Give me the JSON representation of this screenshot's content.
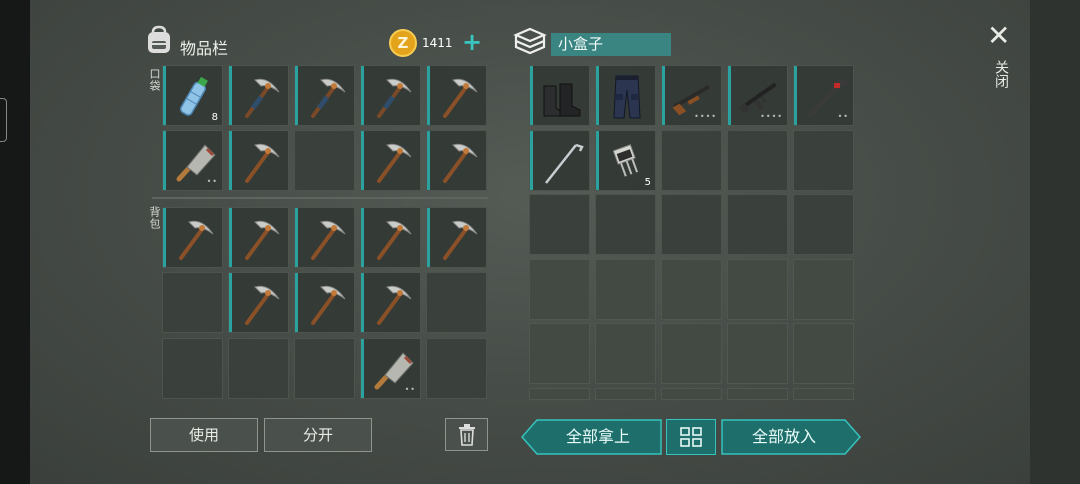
{
  "inventory": {
    "title": "物品栏",
    "icon": "backpack-icon",
    "currency": {
      "icon": "gold-coin-icon",
      "symbol": "Z",
      "amount": "1411",
      "add_label": "+"
    },
    "pockets_label": "口袋",
    "backpack_label": "背包",
    "pockets": [
      {
        "item": "water-bottle",
        "qty": "8"
      },
      {
        "item": "pickaxe-blue"
      },
      {
        "item": "pickaxe-blue"
      },
      {
        "item": "pickaxe-blue"
      },
      {
        "item": "pickaxe"
      },
      {
        "item": "cleaver",
        "dots": "••"
      },
      {
        "item": "pickaxe"
      },
      {
        "item": null
      },
      {
        "item": "pickaxe"
      },
      {
        "item": "pickaxe"
      }
    ],
    "backpack": [
      {
        "item": "pickaxe"
      },
      {
        "item": "pickaxe"
      },
      {
        "item": "pickaxe"
      },
      {
        "item": "pickaxe"
      },
      {
        "item": "pickaxe"
      },
      {
        "item": null
      },
      {
        "item": "pickaxe"
      },
      {
        "item": "pickaxe"
      },
      {
        "item": "pickaxe"
      },
      {
        "item": null
      },
      {
        "item": null
      },
      {
        "item": null
      },
      {
        "item": null
      },
      {
        "item": "cleaver",
        "dots": "••"
      },
      {
        "item": null
      }
    ],
    "use_label": "使用",
    "split_label": "分开",
    "trash_icon": "trash-icon"
  },
  "container": {
    "title": "小盒子",
    "icon": "crate-icon",
    "slots": [
      {
        "item": "boots"
      },
      {
        "item": "tactical-pants"
      },
      {
        "item": "shotgun",
        "dots": "••••"
      },
      {
        "item": "assault-rifle",
        "dots": "••••"
      },
      {
        "item": "crowbar",
        "dots": "••"
      },
      {
        "item": "golf-club"
      },
      {
        "item": "transistor",
        "qty": "5"
      }
    ],
    "take_all_label": "全部拿上",
    "put_all_label": "全部放入",
    "sort_icon": "sort-grid-icon"
  },
  "close": {
    "icon": "close-icon",
    "label": "关闭"
  },
  "colors": {
    "accent": "#2aa3a0",
    "teal_button": "#1e6e6b",
    "coin": "#e3a41b"
  }
}
